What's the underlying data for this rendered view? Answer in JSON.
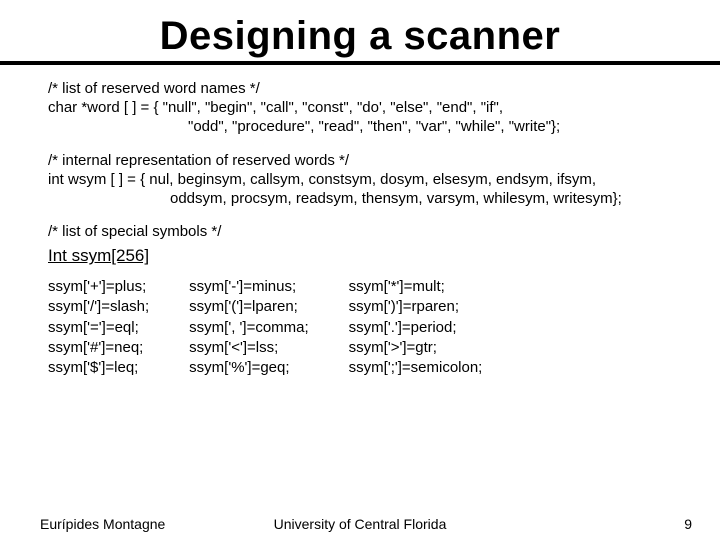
{
  "title": "Designing a scanner",
  "reserved_comment": "/* list of reserved word names */",
  "reserved_line1": "char  *word [ ] = {  \"null\", \"begin\", \"call\", \"const\", \"do', \"else\", \"end\", \"if\",",
  "reserved_line2": "\"odd\", \"procedure\", \"read\", \"then\", \"var\", \"while\", \"write\"};",
  "internal_comment": "/* internal representation  of reserved words */",
  "internal_line1": "int  wsym [ ] = { nul, beginsym, callsym, constsym, dosym, elsesym, endsym, ifsym,",
  "internal_line2": "oddsym, procsym, readsym, thensym, varsym, whilesym, writesym};",
  "special_comment": "/* list of special symbols */",
  "special_decl": "Int ssym[256]",
  "col1": "ssym['+']=plus;\nssym['/']=slash;\nssym['=']=eql;\nssym['#']=neq;\nssym['$']=leq;",
  "col2": "ssym['-']=minus;\nssym['(']=lparen;\nssym[', ']=comma;\nssym['<']=lss;\nssym['%']=geq;",
  "col3": "ssym['*']=mult;\nssym[')']=rparen;\nssym['.']=period;\nssym['>']=gtr;\nssym[';']=semicolon;",
  "footer": {
    "left": "Eurípides Montagne",
    "center": "University of Central Florida",
    "right": "9"
  }
}
